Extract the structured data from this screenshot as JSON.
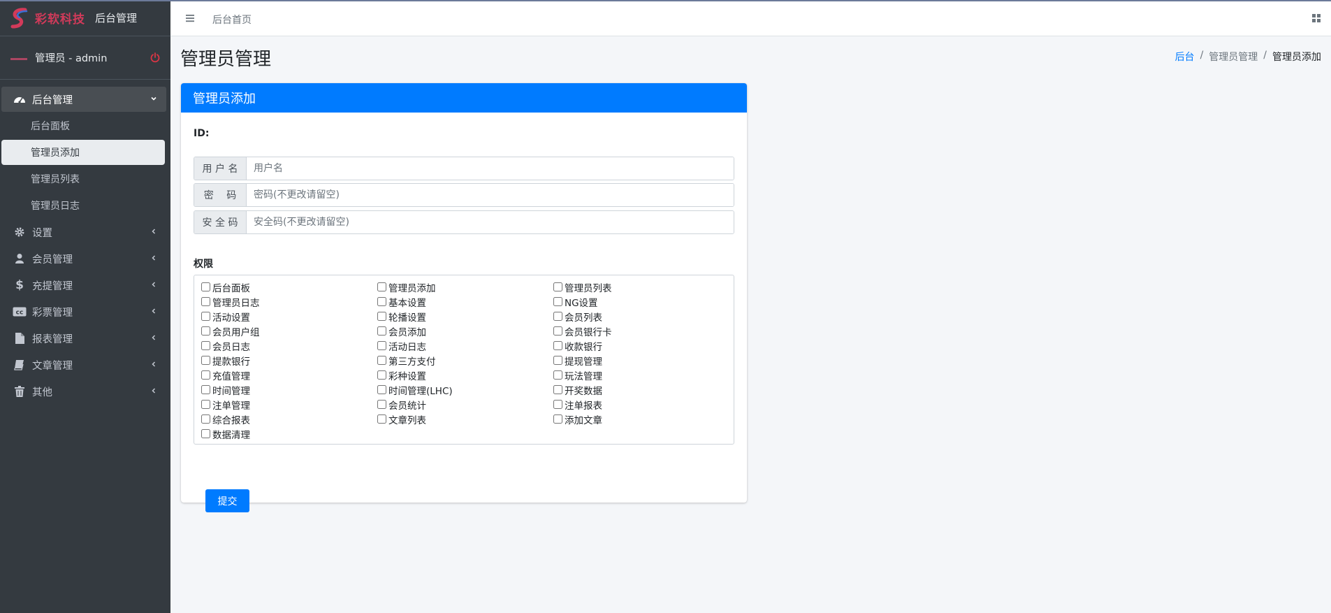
{
  "brand": {
    "logo_text": "彩软科技",
    "title": "后台管理"
  },
  "user": {
    "name": "管理员 - admin"
  },
  "sidebar": {
    "open_group": {
      "label": "后台管理",
      "icon": "dashboard-icon"
    },
    "sub_items": [
      {
        "label": "后台面板"
      },
      {
        "label": "管理员添加"
      },
      {
        "label": "管理员列表"
      },
      {
        "label": "管理员日志"
      }
    ],
    "groups": [
      {
        "label": "设置",
        "icon": "gear-icon"
      },
      {
        "label": "会员管理",
        "icon": "user-icon"
      },
      {
        "label": "充提管理",
        "icon": "dollar-icon"
      },
      {
        "label": "彩票管理",
        "icon": "cc-icon"
      },
      {
        "label": "报表管理",
        "icon": "file-icon"
      },
      {
        "label": "文章管理",
        "icon": "book-icon"
      },
      {
        "label": "其他",
        "icon": "trash-icon"
      }
    ]
  },
  "header": {
    "home": "后台首页"
  },
  "page": {
    "title": "管理员管理"
  },
  "breadcrumb": {
    "items": [
      "后台",
      "/",
      "管理员管理",
      "/",
      "管理员添加"
    ]
  },
  "card": {
    "title": "管理员添加"
  },
  "form": {
    "id_label": "ID:",
    "username": {
      "label": "用 户 名",
      "placeholder": "用户名",
      "value": ""
    },
    "password": {
      "label": "密　 码",
      "placeholder": "密码(不更改请留空)",
      "value": ""
    },
    "safe_code": {
      "label": "安 全 码",
      "placeholder": "安全码(不更改请留空)",
      "value": ""
    },
    "perm_label": "权限",
    "permissions": [
      "后台面板",
      "管理员添加",
      "管理员列表",
      "管理员日志",
      "基本设置",
      "NG设置",
      "活动设置",
      "轮播设置",
      "会员列表",
      "会员用户组",
      "会员添加",
      "会员银行卡",
      "会员日志",
      "活动日志",
      "收款银行",
      "提款银行",
      "第三方支付",
      "提现管理",
      "充值管理",
      "彩种设置",
      "玩法管理",
      "时间管理",
      "时间管理(LHC)",
      "开奖数据",
      "注单管理",
      "会员统计",
      "注单报表",
      "综合报表",
      "文章列表",
      "添加文章",
      "数据清理"
    ],
    "submit": "提交"
  },
  "colors": {
    "primary": "#007bff",
    "sidebar": "#343a40",
    "power": "#dc3545",
    "brand": "#d23a5a"
  }
}
